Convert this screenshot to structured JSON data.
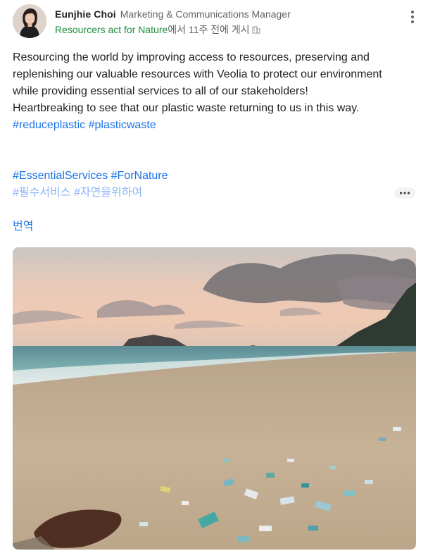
{
  "post": {
    "author_name": "Eunjhie Choi",
    "author_role": "Marketing & Communications Manager",
    "community": "Resourcers act for Nature",
    "posted_meta": "에서 11주 전에 게시",
    "body_lines": [
      "Resourcing the world by improving access to resources, preserving and",
      "replenishing our valuable resources with Veolia to protect our environment",
      "while providing essential services to all of our stakeholders!",
      "Heartbreaking to see that our plastic waste returning to us in this way."
    ],
    "hashtags_1": [
      "#reduceplastic",
      "#plasticwaste"
    ],
    "hashtags_2": [
      "#EssentialServices",
      "#ForNature"
    ],
    "hashtags_ko": [
      "#필수서비스",
      "#자연을위하여"
    ],
    "translate_label": "번역"
  },
  "icons": {
    "more": "more-vert-icon",
    "visibility": "building-icon",
    "ellipsis": "more-horiz-icon"
  },
  "colors": {
    "hashtag": "#1a73e8",
    "hashtag_ko": "#8ab4f8",
    "community": "#1e8e3e",
    "secondary_text": "#5f6368"
  }
}
